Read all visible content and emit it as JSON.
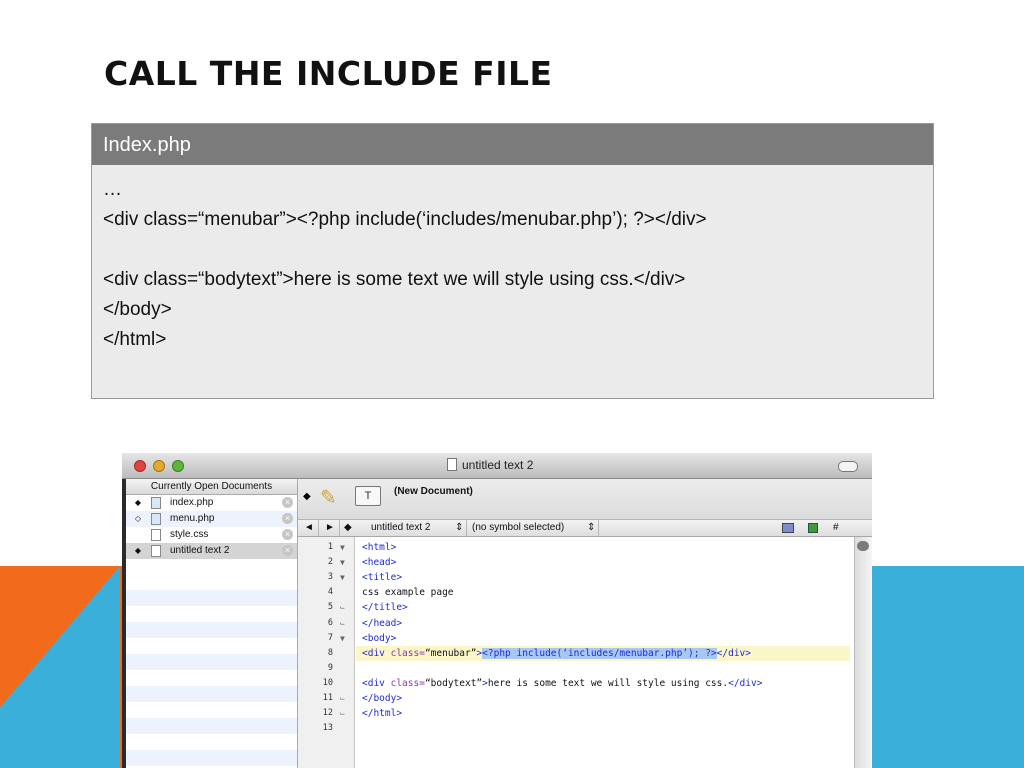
{
  "slide": {
    "title": "CALL THE INCLUDE FILE",
    "table_header": "Index.php",
    "table_lines": [
      "…",
      "<div class=“menubar”><?php include(‘includes/menubar.php’); ?></div>",
      "",
      "<div class=“bodytext”>here is some text we will style using css.</div>",
      "</body>",
      "</html>"
    ]
  },
  "window": {
    "title": "untitled text 2",
    "sidebar_header": "Currently Open Documents",
    "documents": [
      {
        "name": "index.php",
        "bullet": "◆",
        "icon": "php-file-icon"
      },
      {
        "name": "menu.php",
        "bullet": "◇",
        "icon": "php-file-icon"
      },
      {
        "name": "style.css",
        "bullet": "",
        "icon": "css-file-icon"
      },
      {
        "name": "untitled text 2",
        "bullet": "◆",
        "icon": "text-file-icon"
      }
    ],
    "toolbar": {
      "new_document_label": "(New Document)",
      "text_icon_label": "T"
    },
    "nav": {
      "back": "◄",
      "forward": "►",
      "diamond": "◆",
      "doc_name": "untitled text 2",
      "stepper": "⇕",
      "symbol": "(no symbol selected)",
      "hash": "#"
    },
    "editor_lines": [
      {
        "n": "1",
        "fold": "▼",
        "text": "<html>"
      },
      {
        "n": "2",
        "fold": "▼",
        "text": "<head>"
      },
      {
        "n": "3",
        "fold": "▼",
        "text": "<title>"
      },
      {
        "n": "4",
        "fold": "",
        "text": "css example page"
      },
      {
        "n": "5",
        "fold": "⌙",
        "text": "</title>"
      },
      {
        "n": "6",
        "fold": "⌙",
        "text": "</head>"
      },
      {
        "n": "7",
        "fold": "▼",
        "text": "<body>"
      },
      {
        "n": "8",
        "fold": "",
        "text": "<div class=“menubar”><?php include(‘includes/menubar.php’); ?></div>"
      },
      {
        "n": "9",
        "fold": "",
        "text": ""
      },
      {
        "n": "10",
        "fold": "",
        "text": "<div class=“bodytext”>here is some text we will style using css.</div>"
      },
      {
        "n": "11",
        "fold": "⌙",
        "text": "</body>"
      },
      {
        "n": "12",
        "fold": "⌙",
        "text": "</html>"
      },
      {
        "n": "13",
        "fold": "",
        "text": ""
      }
    ]
  },
  "colors": {
    "header_gray": "#7b7b7c",
    "orange": "#f26b1d",
    "blue": "#3aafd9",
    "tag_blue": "#1f2ad6"
  }
}
